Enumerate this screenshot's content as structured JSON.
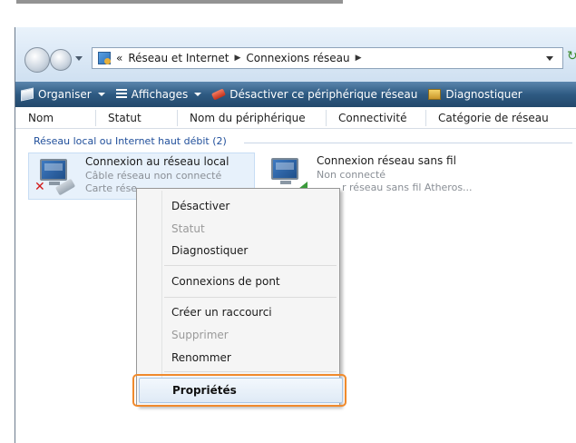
{
  "addressbar": {
    "prefix": "«",
    "crumbs": [
      "Réseau et Internet",
      "Connexions réseau"
    ]
  },
  "toolbar": {
    "organize": "Organiser",
    "views": "Affichages",
    "disable_device": "Désactiver ce périphérique réseau",
    "diagnose": "Diagnostiquer"
  },
  "columns": [
    "Nom",
    "Statut",
    "Nom du périphérique",
    "Connectivité",
    "Catégorie de réseau"
  ],
  "group": {
    "label": "Réseau local ou Internet haut débit (2)"
  },
  "connections": [
    {
      "title": "Connexion au réseau local",
      "status": "Câble réseau non connecté",
      "device": "Carte rése"
    },
    {
      "title": "Connexion réseau sans fil",
      "status": "Non connecté",
      "device": "r réseau sans fil Atheros..."
    }
  ],
  "context_menu": {
    "items": [
      "Désactiver",
      "Statut",
      "Diagnostiquer",
      "Connexions de pont",
      "Créer un raccourci",
      "Supprimer",
      "Renommer"
    ],
    "properties": "Propriétés"
  },
  "colors": {
    "toolbar": "#2e5a82",
    "highlight": "#f08a2c",
    "group_text": "#1f4e9a"
  }
}
